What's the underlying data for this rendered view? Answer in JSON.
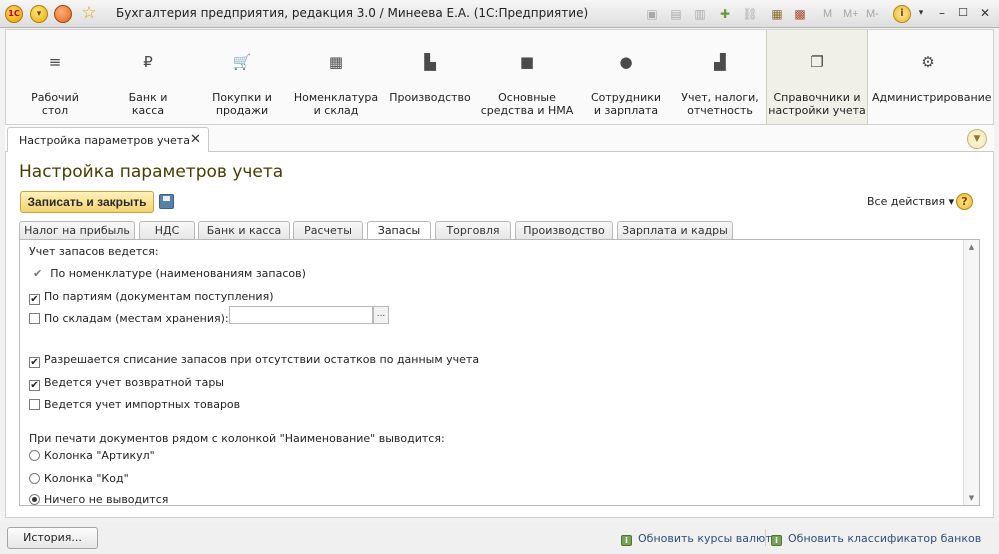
{
  "window": {
    "title": "Бухгалтерия предприятия, редакция 3.0 / Минеева Е.А.  (1С:Предприятие)",
    "logo_text": "1С",
    "right_tools": [
      "M",
      "M+",
      "M-"
    ]
  },
  "sections": [
    {
      "label": "Рабочий стол",
      "icon": "≡"
    },
    {
      "label": "Банк и касса",
      "icon": "₽"
    },
    {
      "label": "Покупки и продажи",
      "icon": "🛒"
    },
    {
      "label": "Номенклатура и склад",
      "icon": "▦"
    },
    {
      "label": "Производство",
      "icon": "▙"
    },
    {
      "label": "Основные средства и НМА",
      "icon": "■"
    },
    {
      "label": "Сотрудники и зарплата",
      "icon": "●"
    },
    {
      "label": "Учет, налоги, отчетность",
      "icon": "▟"
    },
    {
      "label": "Справочники и настройки учета",
      "icon": "❐"
    },
    {
      "label": "Администрирование",
      "icon": "⚙"
    }
  ],
  "open_tab": {
    "label": "Настройка параметров учета",
    "close": "✕"
  },
  "form": {
    "title": "Настройка параметров учета",
    "save_label": "Записать и закрыть",
    "all_actions": "Все действия ▾",
    "help": "?"
  },
  "tabs": [
    "Налог на прибыль",
    "НДС",
    "Банк и касса",
    "Расчеты",
    "Запасы",
    "Торговля",
    "Производство",
    "Зарплата и кадры"
  ],
  "active_tab": "Запасы",
  "inventory": {
    "heading": "Учет запасов ведется:",
    "by_nomenclature": "По номенклатуре (наименованиям запасов)",
    "by_batches": "По партиям (документам поступления)",
    "by_batches_checked": true,
    "by_warehouses": "По складам (местам хранения):",
    "by_warehouses_checked": false,
    "warehouse_value": "",
    "select_btn": "...",
    "allow_writeoff": "Разрешается списание запасов при отсутствии остатков по данным учета",
    "allow_writeoff_checked": true,
    "returnable_packaging": "Ведется учет возвратной тары",
    "returnable_packaging_checked": true,
    "imported_goods": "Ведется учет импортных товаров",
    "imported_goods_checked": false,
    "print_heading": "При печати документов рядом с колонкой \"Наименование\" выводится:",
    "radio_options": [
      "Колонка \"Артикул\"",
      "Колонка \"Код\"",
      "Ничего не выводится"
    ],
    "radio_selected": 2
  },
  "statusbar": {
    "history": "История...",
    "link1": "Обновить курсы валют",
    "link2": "Обновить классификатор банков"
  },
  "colors": {
    "accent": "#f3d271",
    "title": "#4a3c00",
    "link": "#2f4e7a"
  }
}
